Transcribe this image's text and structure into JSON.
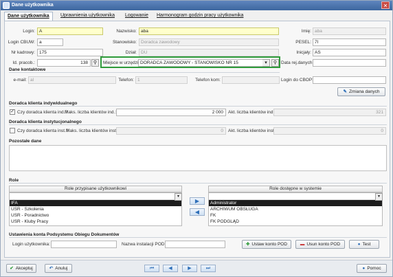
{
  "window": {
    "title": "Dane użytkownika",
    "close": "✕"
  },
  "tabs": [
    "Dane użytkownika",
    "Uprawnienia użytkownika",
    "Logowanie",
    "Harmonogram godzin pracy użytkownika"
  ],
  "user": {
    "login_label": "Login:",
    "login": "A",
    "nazwisko_label": "Nazwisko:",
    "nazwisko": "aba",
    "imie_label": "Imię:",
    "imie": "aba",
    "login_cbuw_label": "Login CBUW:",
    "login_cbuw": "a",
    "stanowisko_label": "Stanowisko:",
    "stanowisko": "Doradca zawodowy",
    "pesel_label": "PESEL:",
    "pesel": "7I",
    "nr_kadrowy_label": "Nr kadrowy:",
    "nr_kadrowy": "175",
    "dzial_label": "Dział:",
    "dzial": "DU",
    "inicjaly_label": "Inicjały:",
    "inicjaly": "AS",
    "id_pracob_label": "Id. pracob.:",
    "id_pracob": "138",
    "miejsce_label": "Miejsce w urzędzie:",
    "miejsce": "DORADCA ZAWODOWY - STANOWISKO NR 15",
    "data_rej_label": "Data rej.danych:",
    "data_rej": ""
  },
  "contact": {
    "section": "Dane kontaktowe",
    "email_label": "e-mail:",
    "email": "al",
    "telefon_label": "Telefon:",
    "telefon": "1",
    "telefon_kom_label": "Telefon kom:",
    "telefon_kom": "",
    "login_cbop_label": "Login do CBOP:",
    "login_cbop": "",
    "zmiana_button": "Zmiana danych"
  },
  "doradca_ind": {
    "section": "Doradca klienta indywidualnego",
    "checkbox_label": "Czy doradca klienta ind.?",
    "checked": true,
    "max_label": "Maks. liczba klientów ind.:",
    "max": "2 000",
    "akt_label": "Akt. liczba klientów ind.:",
    "akt": "321"
  },
  "doradca_inst": {
    "section": "Doradca klienta instytucjonalnego",
    "checkbox_label": "Czy doradca klienta inst.?",
    "checked": false,
    "max_label": "Maks. liczba klientów inst.:",
    "max": "0",
    "akt_label": "Akt. liczba klientów inst.:",
    "akt": "0"
  },
  "pozostale": {
    "section": "Pozostałe dane"
  },
  "role": {
    "section": "Role",
    "assigned_header": "Role przypisane użytkownikowi",
    "assigned": [
      "IFA",
      "USR - Szkolenia",
      "USR - Poradnictwo",
      "USR - Kluby Pracy"
    ],
    "available_header": "Role dostępne w systemie",
    "available": [
      "Administrator",
      "ARCHIWUM OBSŁUGA",
      "FK",
      "FK PODGLĄD"
    ]
  },
  "pod": {
    "section": "Ustawienia konta Podsystemu Obiegu Dokumentów",
    "login_label": "Login użytkownika:",
    "login": "",
    "instalacja_label": "Nazwa instalacji POD:",
    "instalacja": "",
    "ustaw_button": "Ustaw konto POD",
    "usun_button": "Usun konto POD",
    "test_button": "Test"
  },
  "footer": {
    "akceptuj": "Akceptuj",
    "anuluj": "Anuluj",
    "pomoc": "Pomoc"
  },
  "colors": {
    "title_bar": "#3d679f",
    "selected_row": "#1d1d1d",
    "required_field": "#ffffcc",
    "highlight_border": "#2e9b3a"
  }
}
